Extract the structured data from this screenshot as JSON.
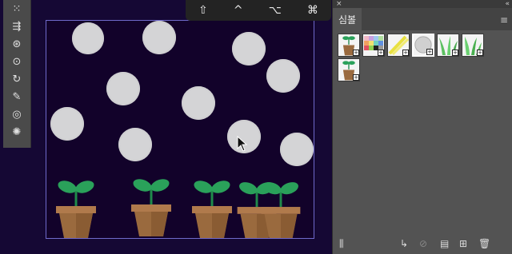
{
  "topbar": {
    "keys": [
      "⇧",
      "^",
      "⌥",
      "⌘"
    ]
  },
  "toolbar": {
    "tools": [
      {
        "name": "symbol-sprayer-icon",
        "glyph": "⁙"
      },
      {
        "name": "symbol-shifter-icon",
        "glyph": "⇶"
      },
      {
        "name": "symbol-scruncher-icon",
        "glyph": "⊛"
      },
      {
        "name": "symbol-sizer-icon",
        "glyph": "⊙"
      },
      {
        "name": "symbol-spinner-icon",
        "glyph": "↻"
      },
      {
        "name": "symbol-stainer-icon",
        "glyph": "✎"
      },
      {
        "name": "symbol-screener-icon",
        "glyph": "◎"
      },
      {
        "name": "symbol-styler-icon",
        "glyph": "✺"
      }
    ]
  },
  "panel": {
    "close_glyph": "×",
    "collapse_glyph": "«",
    "tab_label": "심볼",
    "menu_glyph": "≡",
    "symbols": [
      {
        "name": "symbol-plant"
      },
      {
        "name": "symbol-color-grid"
      },
      {
        "name": "symbol-yellow-strokes"
      },
      {
        "name": "symbol-gray-circle"
      },
      {
        "name": "symbol-grass-1"
      },
      {
        "name": "symbol-grass-2"
      },
      {
        "name": "symbol-plant-small"
      }
    ],
    "swatch_badge": "+",
    "footer": {
      "library_glyph": "⫼",
      "place_glyph": "↳",
      "break_link_glyph": "⊘",
      "options_glyph": "▤",
      "new_glyph": "⊞",
      "delete_glyph": "🗑"
    }
  }
}
